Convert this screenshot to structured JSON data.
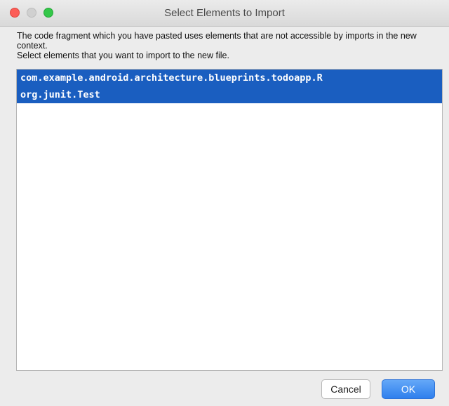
{
  "window": {
    "title": "Select Elements to Import"
  },
  "message": {
    "line1": "The code fragment which you have pasted uses elements that are not accessible by imports in the new context.",
    "line2": "Select elements that you want to import to the new file."
  },
  "elements": [
    {
      "label": "com.example.android.architecture.blueprints.todoapp.R",
      "selected": true
    },
    {
      "label": "org.junit.Test",
      "selected": true
    }
  ],
  "buttons": {
    "cancel_label": "Cancel",
    "ok_label": "OK"
  },
  "colors": {
    "selection": "#1a5ec0",
    "default_button": "#3a87f0"
  }
}
